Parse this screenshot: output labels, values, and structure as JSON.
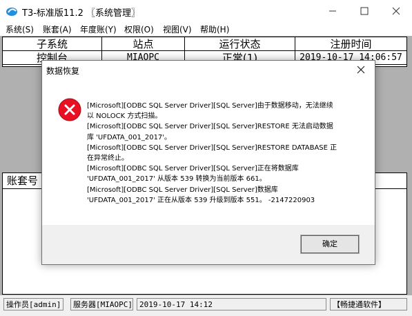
{
  "window": {
    "title": "T3-标准版11.2 〖系统管理〗",
    "minimize_icon": "minimize-icon",
    "maximize_icon": "maximize-icon",
    "close_icon": "close-icon"
  },
  "menu": [
    "系统(S)",
    "账套(A)",
    "年度账(Y)",
    "权限(O)",
    "视图(V)",
    "帮助(H)"
  ],
  "grid": {
    "headers": [
      "子系统",
      "站点",
      "运行状态",
      "注册时间"
    ],
    "rows": [
      [
        "控制台",
        "MIAOPC",
        "正常(1)",
        "2019-10-17 14:06:57"
      ]
    ]
  },
  "lower_grid": {
    "headers": [
      "账套号"
    ]
  },
  "dialog": {
    "title": "数据恢复",
    "icon": "error-icon",
    "message_lines": [
      "[Microsoft][ODBC SQL Server Driver][SQL Server]由于数据移动，无法继续",
      "以 NOLOCK 方式扫描。",
      "[Microsoft][ODBC SQL Server Driver][SQL Server]RESTORE 无法启动数据",
      "库 'UFDATA_001_2017'。",
      "[Microsoft][ODBC SQL Server Driver][SQL Server]RESTORE DATABASE 正",
      "在异常终止。",
      "[Microsoft][ODBC SQL Server Driver][SQL Server]正在将数据库",
      "'UFDATA_001_2017' 从版本 539 转换为当前版本 661。",
      "[Microsoft][ODBC SQL Server Driver][SQL Server]数据库",
      "'UFDATA_001_2017' 正在从版本 539 升级到版本 551。 -2147220903"
    ],
    "ok_label": "确定"
  },
  "statusbar": {
    "operator": "操作员[admin]",
    "server": "服务器[MIAOPC]",
    "datetime": "2019-10-17 14:12",
    "brand": "【畅捷通软件】"
  },
  "colors": {
    "workspace": "#b0b0b0",
    "dialog_bg": "#f0f0f0",
    "error_red": "#e81123"
  }
}
